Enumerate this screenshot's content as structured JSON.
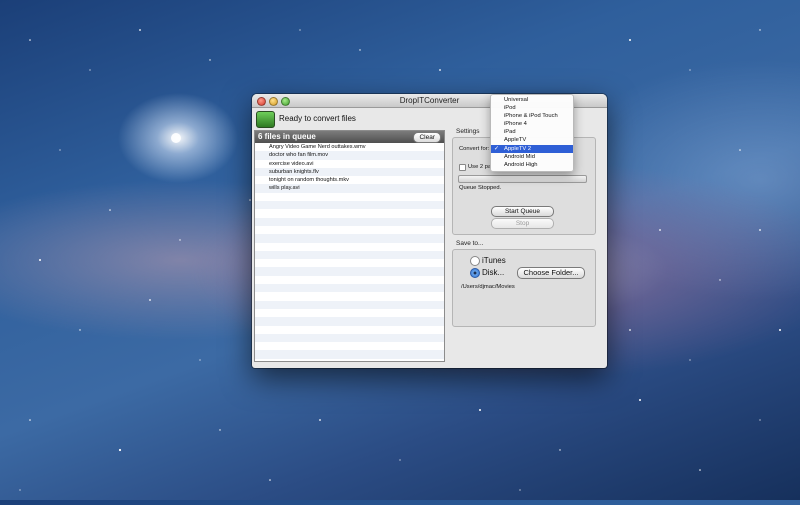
{
  "window": {
    "title": "DropITConverter",
    "status": "Ready to convert files"
  },
  "queue": {
    "header": "6 files in queue",
    "clear_label": "Clear",
    "files": [
      "Angry Video Game Nerd outtakes.wmv",
      "doctor who fan film.mov",
      "exercise video.avi",
      "suburban knights.flv",
      "tonight on random thoughts.mkv",
      "wills play.avi"
    ]
  },
  "settings": {
    "group_label": "Settings",
    "convert_for_label": "Convert for:",
    "use_passes_label": "Use 2 pa",
    "queue_status": "Queue Stopped.",
    "start_label": "Start Queue",
    "stop_label": "Stop"
  },
  "save_to": {
    "group_label": "Save to...",
    "itunes_label": "iTunes",
    "disk_label": "Disk...",
    "choose_folder_label": "Choose Folder...",
    "path": "/Users/djmac/Movies"
  },
  "menu": {
    "options": [
      "Universal",
      "iPod",
      "iPhone & iPod Touch",
      "iPhone 4",
      "iPad",
      "AppleTV",
      "AppleTV 2",
      "Android Mid",
      "Android High"
    ],
    "selected": "AppleTV 2",
    "check": "✓"
  }
}
